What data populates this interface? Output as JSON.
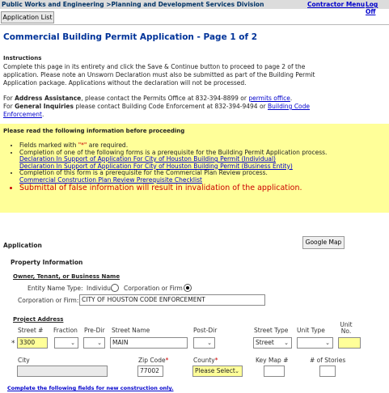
{
  "header": {
    "breadcrumb": "Public Works and Engineering >Planning and Development Services Division",
    "contractor_menu": "Contractor Menu",
    "log_off": "Log Off"
  },
  "nav": {
    "application_list": "Application List"
  },
  "page_title": "Commercial Building Permit Application - Page 1 of 2",
  "instructions": {
    "heading": "Instructions",
    "body": "Complete this page in its entirety and click the Save & Continue button to proceed to page 2 of the application. Please note an Unsworn Declaration must also be submitted as part of the Building Permit Application package.   Applications without the declaration will not be processed.",
    "address_prefix": "For ",
    "address_bold": "Address Assistance",
    "address_mid": ", please contact the Permits Office at 832-394-8899 or ",
    "address_link": "permits office",
    "address_end": ".",
    "general_prefix": "For ",
    "general_bold": "General Inquiries",
    "general_mid": " please contact Building Code Enforcement at 832-394-9494 or ",
    "general_link": "Building Code Enforcement",
    "general_end": "."
  },
  "notice": {
    "heading": "Please read the following information before proceeding",
    "req_prefix": "Fields marked with ",
    "req_mark": "\"*\"",
    "req_suffix": " are required.",
    "prereq1": "Completion of one of the following forms is a prerequisite for the Building Permit Application process.",
    "decl_individual": "Declaration In Support of Application For City of Houston Building Permit (Individual)",
    "decl_business": "Declaration In Support of Application For City of Houston Building Permit (Business Entity)",
    "prereq2": "Completion of this form is a prerequisite for the Commercial Plan Review process.",
    "checklist": "Commercial Construction Plan Review Prerequisite Checklist",
    "false_info": "Submittal of false information will result in invalidation of the application."
  },
  "application": {
    "heading": "Application",
    "google_map": "Google Map",
    "property_heading": "Property Information",
    "owner_heading": "Owner, Tenant, or Business Name",
    "entity_label": "Entity Name Type:",
    "entity_individual": "Individual",
    "entity_corp": "Corporation or Firm",
    "entity_selected": "Corporation or Firm",
    "corp_label": "Corporation or Firm:",
    "corp_value": "CITY OF HOUSTON CODE ENFORCEMENT",
    "project_heading": "Project Address",
    "col_street_num": "Street #",
    "col_fraction": "Fraction",
    "col_predir": "Pre-Dir",
    "col_street_name": "Street Name",
    "col_postdir": "Post-Dir",
    "col_street_type": "Street Type",
    "col_unit_type": "Unit Type",
    "col_unit_no": "Unit No.",
    "req_star": "*",
    "street_num_value": "3300",
    "street_name_value": "MAIN",
    "street_type_value": "Street",
    "city_label": "City",
    "zip_label": "Zip Code",
    "zip_value": "77002",
    "county_label": "County",
    "county_value": "Please Select",
    "keymap_label": "Key Map #",
    "stories_label": "# of Stories",
    "new_construction": "Complete the following fields for new construction only."
  },
  "colors": {
    "title_blue": "#003399",
    "notice_yellow": "#ffff99",
    "required_red": "#cc0000",
    "link_blue": "#0000cc"
  }
}
